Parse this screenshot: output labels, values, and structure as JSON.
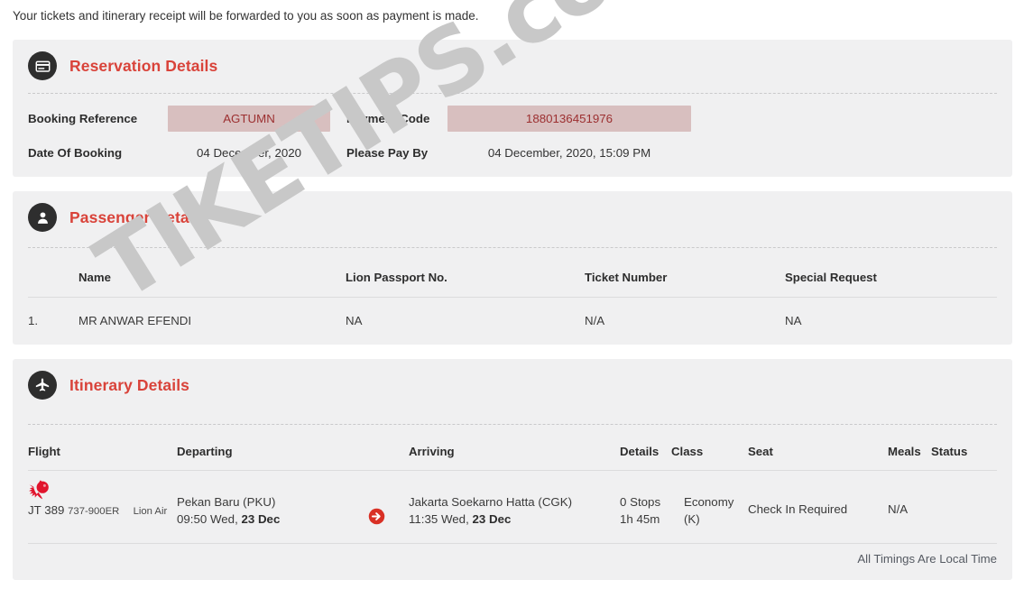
{
  "notice": "Your tickets and itinerary receipt will be forwarded to you as soon as payment is made.",
  "watermark": "TIKETIPS.com",
  "colors": {
    "accent_red": "#d9433a",
    "panel_bg": "#f0f0f1",
    "chip_bg": "#d8bfbf",
    "chip_text": "#9c2f30",
    "icon_circle": "#2e2e2e",
    "lion_logo": "#e1142d",
    "watermark": "#c8c8c8"
  },
  "reservation": {
    "title": "Reservation Details",
    "icon": "credit-card-icon",
    "fields": {
      "booking_reference_label": "Booking Reference",
      "booking_reference_value": "AGTUMN",
      "payment_code_label": "Payment Code",
      "payment_code_value": "1880136451976",
      "date_of_booking_label": "Date Of Booking",
      "date_of_booking_value": "04 December, 2020",
      "please_pay_by_label": "Please Pay By",
      "please_pay_by_value": "04 December, 2020, 15:09 PM"
    }
  },
  "passenger": {
    "title": "Passenger Details",
    "icon": "user-icon",
    "headers": {
      "index": "",
      "name": "Name",
      "passport": "Lion Passport No.",
      "ticket": "Ticket Number",
      "request": "Special Request"
    },
    "rows": [
      {
        "index": "1.",
        "name": "MR ANWAR EFENDI",
        "passport": "NA",
        "ticket": "N/A",
        "request": "NA"
      }
    ]
  },
  "itinerary": {
    "title": "Itinerary Details",
    "icon": "airplane-icon",
    "headers": {
      "flight": "Flight",
      "departing": "Departing",
      "arriving": "Arriving",
      "details": "Details",
      "class": "Class",
      "seat": "Seat",
      "meals": "Meals",
      "status": "Status"
    },
    "rows": [
      {
        "flight_number": "JT 389",
        "aircraft": "737-900ER",
        "airline": "Lion Air",
        "airline_logo": "lion-air-logo",
        "departing_airport": "Pekan Baru (PKU)",
        "departing_time": "09:50 Wed,",
        "departing_date": "23 Dec",
        "arriving_airport": "Jakarta Soekarno Hatta (CGK)",
        "arriving_time": "11:35 Wed,",
        "arriving_date": "23 Dec",
        "stops": "0 Stops",
        "duration": "1h 45m",
        "class": "Economy",
        "class_code": "(K)",
        "seat": "Check In Required",
        "meals": "N/A",
        "status": ""
      }
    ],
    "footnote": "All Timings Are Local Time"
  }
}
